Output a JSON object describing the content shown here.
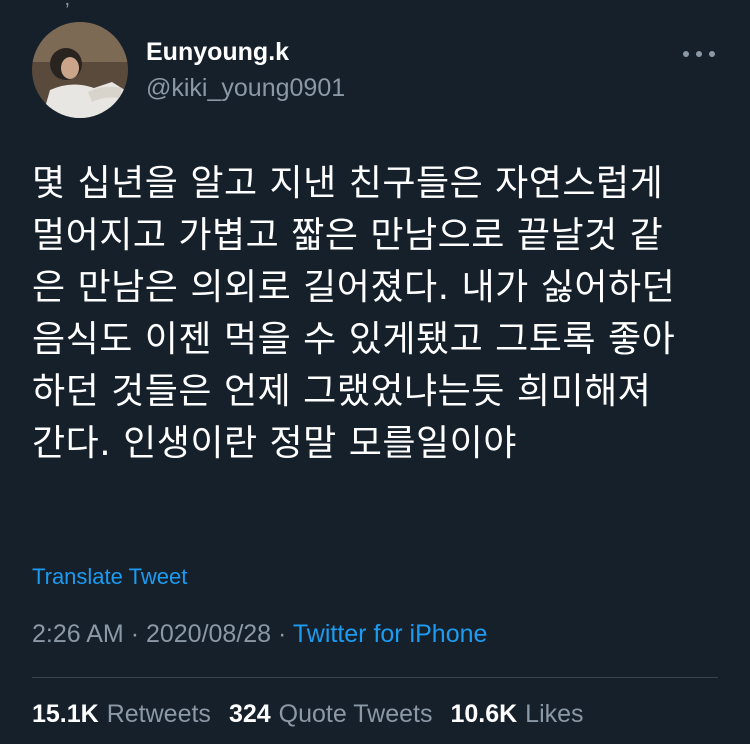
{
  "top_fragment": "ʼ, ʼʼ",
  "user": {
    "display_name": "Eunyoung.k",
    "handle": "@kiki_young0901"
  },
  "tweet": {
    "text": "몇 십년을 알고 지낸 친구들은 자연스럽게\n멀어지고 가볍고 짧은 만남으로 끝날것 같\n은 만남은 의외로 길어졌다. 내가 싫어하던\n음식도 이젠 먹을 수 있게됐고 그토록 좋아\n하던 것들은 언제 그랬었냐는듯 희미해져\n간다. 인생이란 정말 모를일이야",
    "translate_label": "Translate Tweet",
    "time": "2:26 AM",
    "date": "2020/08/28",
    "separator": "·",
    "source": "Twitter for iPhone"
  },
  "stats": {
    "retweets_count": "15.1K",
    "retweets_label": "Retweets",
    "quotes_count": "324",
    "quotes_label": "Quote Tweets",
    "likes_count": "10.6K",
    "likes_label": "Likes"
  },
  "colors": {
    "background": "#15202b",
    "accent": "#1d9bf0",
    "muted": "#8b98a5",
    "divider": "#38444d"
  },
  "icons": {
    "more": "more-horizontal-icon"
  }
}
